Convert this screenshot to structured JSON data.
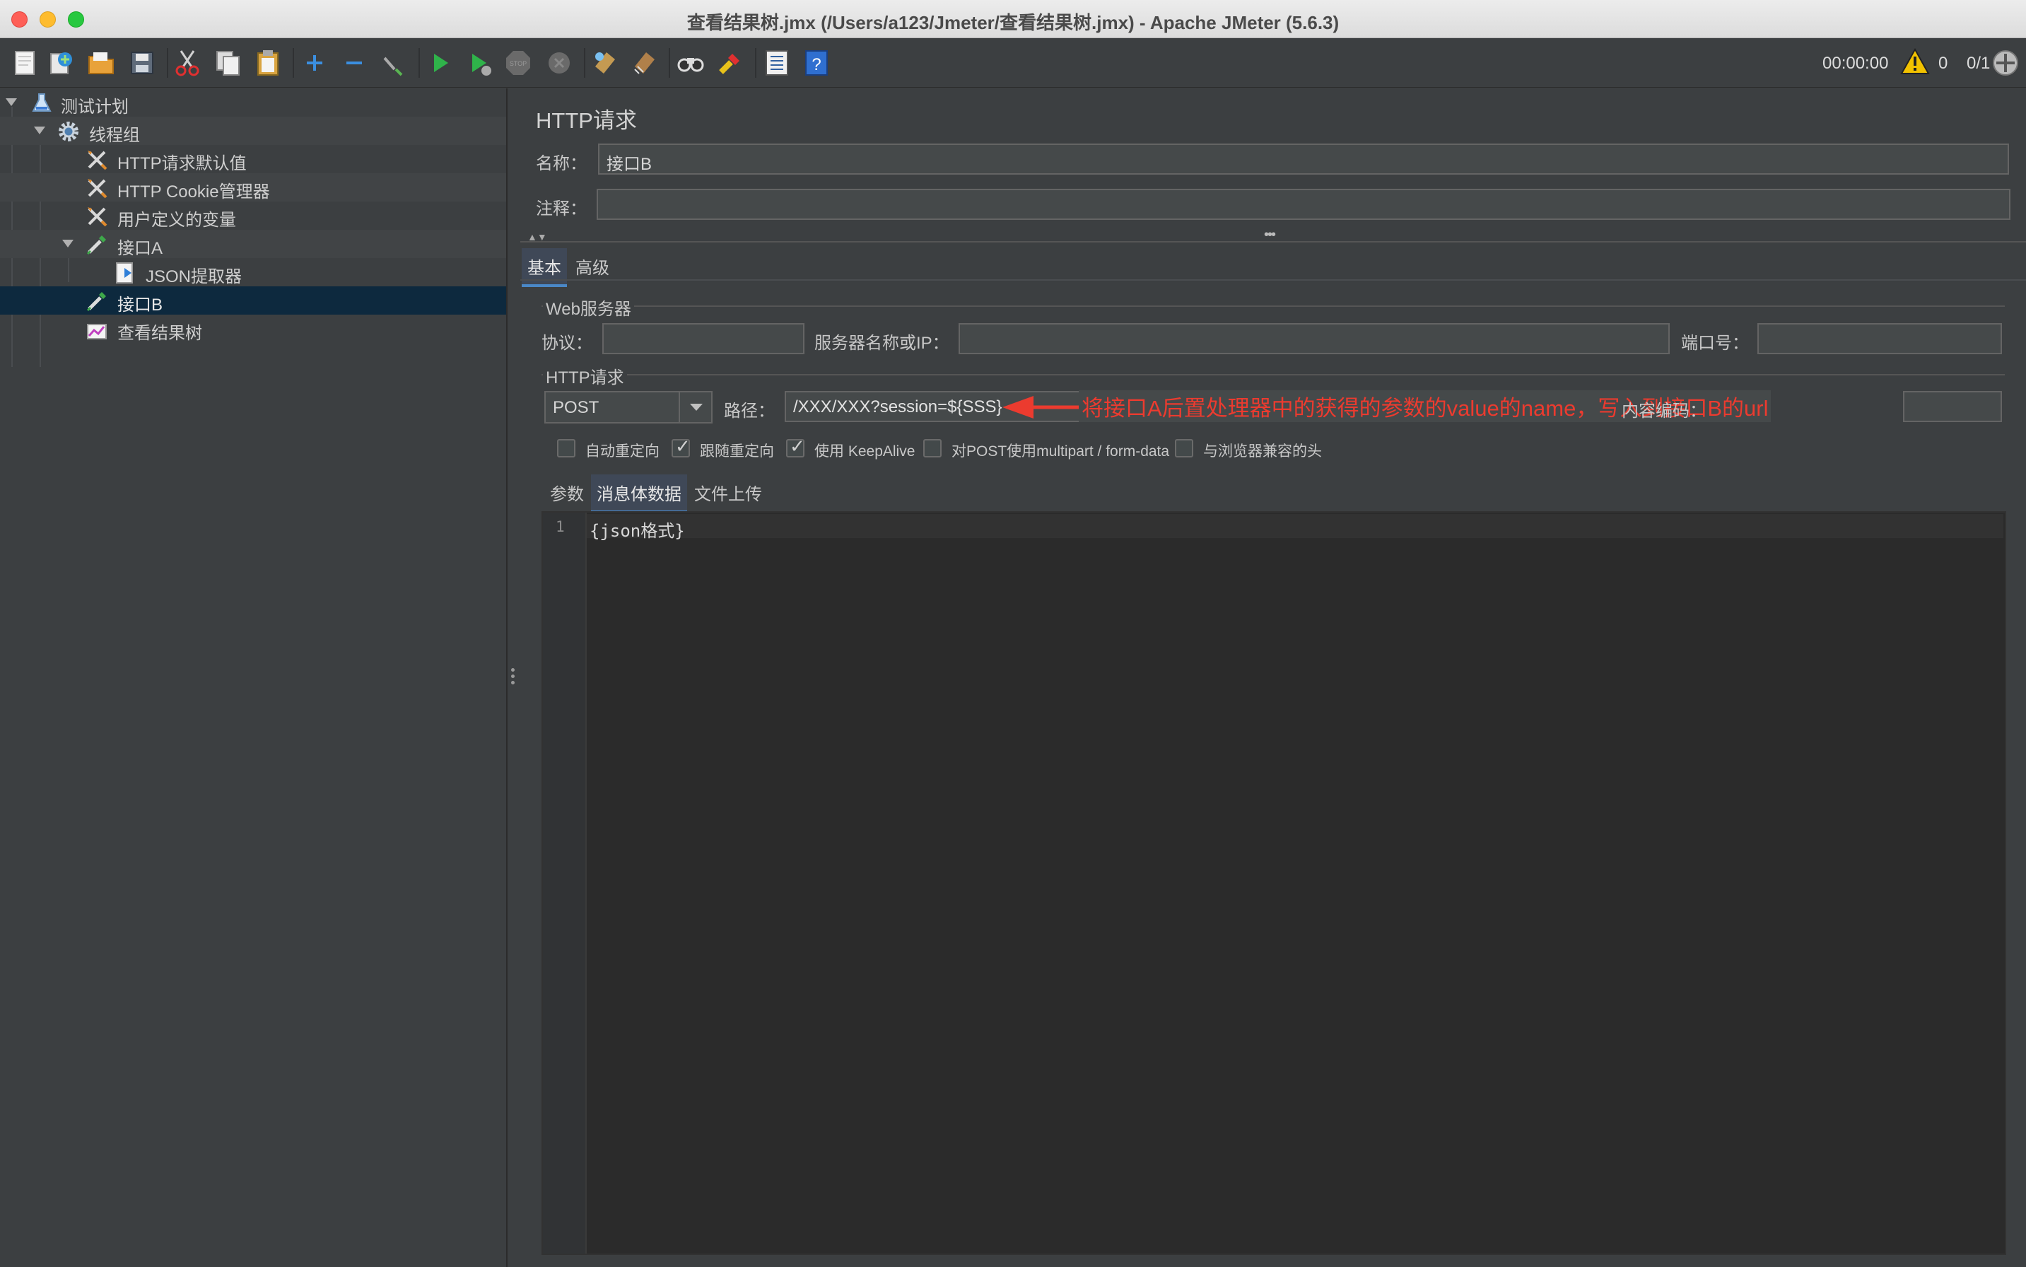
{
  "window": {
    "title": "查看结果树.jmx (/Users/a123/Jmeter/查看结果树.jmx) - Apache JMeter (5.6.3)"
  },
  "toolbar": {
    "icons": [
      "new-icon",
      "templates-icon",
      "open-icon",
      "save-icon",
      "cut-icon",
      "copy-icon",
      "paste-icon",
      "expand-icon",
      "collapse-icon",
      "toggle-icon",
      "start-icon",
      "start-no-pause-icon",
      "stop-icon",
      "shutdown-icon",
      "clear-icon",
      "clear-all-icon",
      "search-icon",
      "reset-search-icon",
      "function-helper-icon",
      "help-icon"
    ],
    "timer": "00:00:00",
    "warning_count": "0",
    "threads": "0/1"
  },
  "tree": {
    "items": [
      {
        "label": "测试计划",
        "icon": "test-plan-icon"
      },
      {
        "label": "线程组",
        "icon": "thread-group-gear-icon"
      },
      {
        "label": "HTTP请求默认值",
        "icon": "config-wrench-icon"
      },
      {
        "label": "HTTP Cookie管理器",
        "icon": "config-wrench-icon"
      },
      {
        "label": "用户定义的变量",
        "icon": "config-wrench-icon"
      },
      {
        "label": "接口A",
        "icon": "sampler-pipette-icon"
      },
      {
        "label": "JSON提取器",
        "icon": "post-processor-icon"
      },
      {
        "label": "接口B",
        "icon": "sampler-pipette-icon"
      },
      {
        "label": "查看结果树",
        "icon": "listener-graph-icon"
      }
    ]
  },
  "panel": {
    "title": "HTTP请求",
    "name_label": "名称：",
    "name_value": "接口B",
    "comment_label": "注释：",
    "comment_value": "",
    "tabs": [
      "基本",
      "高级"
    ],
    "web_server": {
      "group_title": "Web服务器",
      "protocol_label": "协议：",
      "protocol_value": "",
      "server_label": "服务器名称或IP：",
      "server_value": "",
      "port_label": "端口号：",
      "port_value": ""
    },
    "http_request": {
      "group_title": "HTTP请求",
      "method": "POST",
      "path_label": "路径：",
      "path_value": "/XXX/XXX?session=${SSS}",
      "encoding_label": "内容编码：",
      "encoding_value": ""
    },
    "annotation": "将接口A后置处理器中的获得的参数的value的name，写入到接口B的url",
    "options": [
      {
        "label": "自动重定向",
        "checked": false
      },
      {
        "label": "跟随重定向",
        "checked": true
      },
      {
        "label": "使用 KeepAlive",
        "checked": true
      },
      {
        "label": "对POST使用multipart / form-data",
        "checked": false
      },
      {
        "label": "与浏览器兼容的头",
        "checked": false
      }
    ],
    "body_tabs": [
      "参数",
      "消息体数据",
      "文件上传"
    ],
    "editor": {
      "line_number": "1",
      "content": "{json格式}"
    }
  },
  "colors": {
    "accent": "#4a88c7",
    "annotation": "#ec3b2f",
    "selection": "#0d293e"
  }
}
